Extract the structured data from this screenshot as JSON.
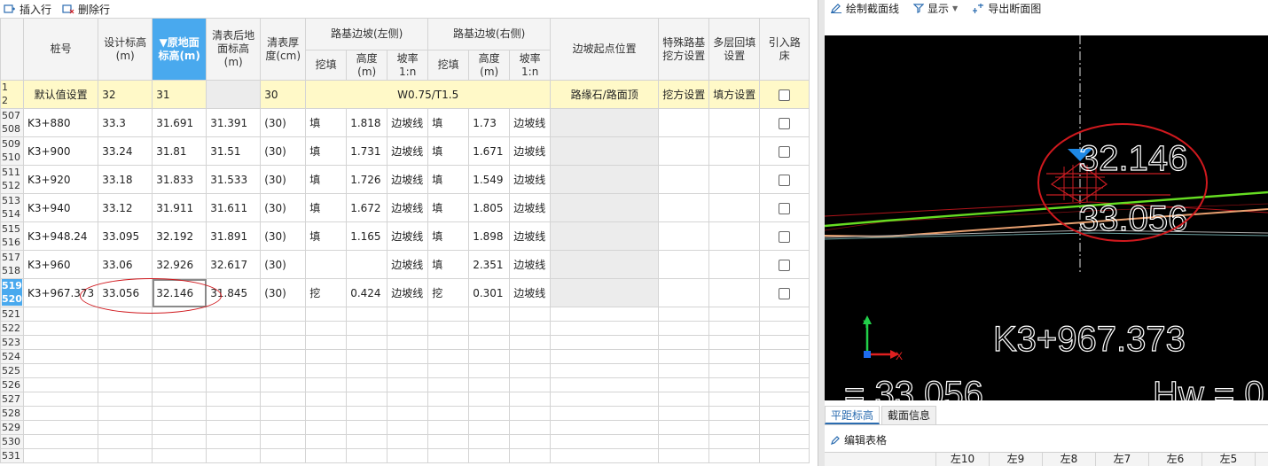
{
  "toolbar_left": {
    "insert_label": "插入行",
    "delete_label": "删除行"
  },
  "toolbar_right": {
    "draw_label": "绘制截面线",
    "display_label": "显示",
    "export_label": "导出断面图"
  },
  "table": {
    "headers": {
      "station": "桩号",
      "design_elev": "设计标高(m)",
      "ground_elev": "▼原地面标高(m)",
      "cleared_elev": "清表后地面标高(m)",
      "clear_thickness": "清表厚度(cm)",
      "left_slope": "路基边坡(左侧)",
      "right_slope": "路基边坡(右侧)",
      "cut_fill": "挖填",
      "height": "高度(m)",
      "ratio": "坡率1:n",
      "slope_start": "边坡起点位置",
      "special_cut": "特殊路基挖方设置",
      "multi_fill": "多层回填设置",
      "bed": "引入路床"
    },
    "default_row": {
      "rn1": "1",
      "rn2": "2",
      "station": "默认值设置",
      "design": "32",
      "ground": "31",
      "cleared": "",
      "thickness": "30",
      "slope": "W0.75/T1.5",
      "slope_start": "路缘石/路面顶",
      "special": "挖方设置",
      "multi": "填方设置"
    },
    "rows": [
      {
        "rn1": "507",
        "rn2": "508",
        "station": "K3+880",
        "design": "33.3",
        "ground": "31.691",
        "cleared": "31.391",
        "thickness": "(30)",
        "l_ct": "填",
        "l_h": "1.818",
        "l_r": "边坡线",
        "r_ct": "填",
        "r_h": "1.73",
        "r_r": "边坡线"
      },
      {
        "rn1": "509",
        "rn2": "510",
        "station": "K3+900",
        "design": "33.24",
        "ground": "31.81",
        "cleared": "31.51",
        "thickness": "(30)",
        "l_ct": "填",
        "l_h": "1.731",
        "l_r": "边坡线",
        "r_ct": "填",
        "r_h": "1.671",
        "r_r": "边坡线"
      },
      {
        "rn1": "511",
        "rn2": "512",
        "station": "K3+920",
        "design": "33.18",
        "ground": "31.833",
        "cleared": "31.533",
        "thickness": "(30)",
        "l_ct": "填",
        "l_h": "1.726",
        "l_r": "边坡线",
        "r_ct": "填",
        "r_h": "1.549",
        "r_r": "边坡线"
      },
      {
        "rn1": "513",
        "rn2": "514",
        "station": "K3+940",
        "design": "33.12",
        "ground": "31.911",
        "cleared": "31.611",
        "thickness": "(30)",
        "l_ct": "填",
        "l_h": "1.672",
        "l_r": "边坡线",
        "r_ct": "填",
        "r_h": "1.805",
        "r_r": "边坡线"
      },
      {
        "rn1": "515",
        "rn2": "516",
        "station": "K3+948.24",
        "design": "33.095",
        "ground": "32.192",
        "cleared": "31.891",
        "thickness": "(30)",
        "l_ct": "填",
        "l_h": "1.165",
        "l_r": "边坡线",
        "r_ct": "填",
        "r_h": "1.898",
        "r_r": "边坡线"
      },
      {
        "rn1": "517",
        "rn2": "518",
        "station": "K3+960",
        "design": "33.06",
        "ground": "32.926",
        "cleared": "32.617",
        "thickness": "(30)",
        "l_ct": "",
        "l_h": "",
        "l_r": "边坡线",
        "r_ct": "填",
        "r_h": "2.351",
        "r_r": "边坡线"
      },
      {
        "rn1": "519",
        "rn2": "520",
        "station": "K3+967.373",
        "design": "33.056",
        "ground": "32.146",
        "cleared": "31.845",
        "thickness": "(30)",
        "l_ct": "挖",
        "l_h": "0.424",
        "l_r": "边坡线",
        "r_ct": "挖",
        "r_h": "0.301",
        "r_r": "边坡线"
      }
    ],
    "empty_rows": [
      "521",
      "522",
      "523",
      "524",
      "525",
      "526",
      "527",
      "528",
      "529",
      "530",
      "531"
    ]
  },
  "cad": {
    "elev_top": "32.146",
    "elev_bottom": "33.056",
    "station": "K3+967.373",
    "axis_x": "X",
    "axis_y": "Y",
    "bottom_left": "= 33.056",
    "bottom_right": "Hw = 0"
  },
  "tabs": {
    "t1": "平距标高",
    "t2": "截面信息"
  },
  "edit_label": "编辑表格",
  "bottom_cols": [
    "左10",
    "左9",
    "左8",
    "左7",
    "左6",
    "左5"
  ],
  "colors": {
    "accent": "#49a9ee",
    "annotation": "#d0191e",
    "default_row_bg": "#fff9c8"
  }
}
